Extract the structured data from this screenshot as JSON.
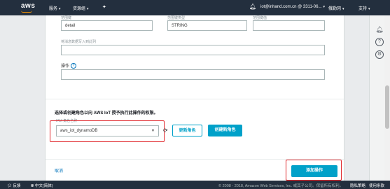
{
  "topbar": {
    "logo": "aws",
    "services": "服务",
    "resource_groups": "资源组",
    "account": "iot@inhand.com.cn @ 3311-06...",
    "region": "俄勒冈",
    "support": "支持"
  },
  "form": {
    "col1_label": "范围键",
    "col1_value": "detail",
    "col2_label": "范围键类型",
    "col2_value": "STRING",
    "col3_label": "范围键值",
    "col3_value": "",
    "write_label": "将消息数据写入到此列",
    "write_value": "",
    "operation_label": "操作",
    "operation_value": ""
  },
  "role": {
    "title": "选择或创建角色以向 AWS IoT 授予执行此操作的权限。",
    "iam_label": "IAM 角色名称",
    "selected": "aws_iot_dynamoDB",
    "update_button": "更新角色",
    "create_button": "创建新角色"
  },
  "actions": {
    "cancel": "取消",
    "add_button": "添加操作"
  },
  "footer": {
    "feedback": "反馈",
    "language": "中文(简体)",
    "copyright": "© 2008 - 2018, Amazon Web Services, Inc. 或其子公司。保留所有权利。",
    "privacy": "隐私策略",
    "terms": "使用条款"
  },
  "icons": {
    "bell": "bell-icon",
    "pin": "pin-icon",
    "help": "help-icon",
    "refresh": "refresh-icon",
    "feedback": "feedback-icon",
    "globe": "globe-icon"
  },
  "colors": {
    "nav": "#232f3e",
    "primary_button": "#00a1c9",
    "highlight": "#e0262b",
    "link": "#0073bb"
  }
}
